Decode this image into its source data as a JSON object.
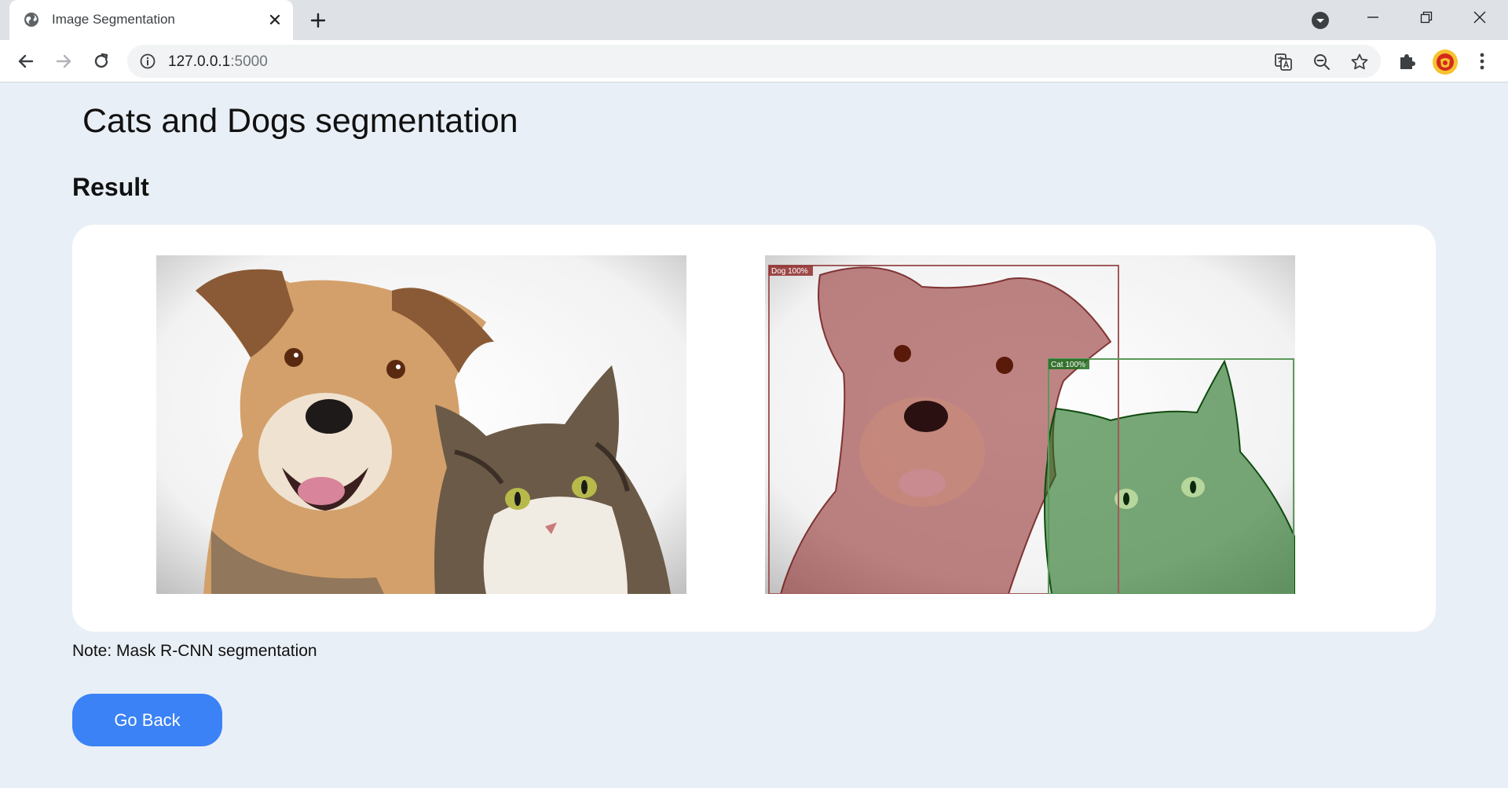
{
  "browser": {
    "tab_title": "Image Segmentation",
    "url_host": "127.0.0.1",
    "url_port": ":5000",
    "icons": {
      "favicon": "globe-icon",
      "tab_close": "close-icon",
      "new_tab": "plus-icon",
      "tab_search": "chevron-down-icon",
      "back": "arrow-left-icon",
      "forward": "arrow-right-icon",
      "reload": "reload-icon",
      "site_info": "info-icon",
      "translate": "translate-icon",
      "zoom": "zoom-out-icon",
      "bookmark": "star-icon",
      "extensions": "puzzle-icon",
      "menu": "kebab-menu-icon"
    },
    "window_controls": [
      "minimize",
      "restore",
      "close"
    ]
  },
  "page": {
    "title": "Cats and Dogs segmentation",
    "section_title": "Result",
    "note": "Note: Mask R-CNN segmentation",
    "go_back_label": "Go Back"
  },
  "images": {
    "original_alt": "Original photo of a dog and a cat",
    "segmented_alt": "Segmented photo with Dog and Cat masks",
    "detections": [
      {
        "label": "Dog 100%",
        "color": "#8b2020"
      },
      {
        "label": "Cat 100%",
        "color": "#1f6e1f"
      }
    ]
  },
  "colors": {
    "page_background": "#e9eff6",
    "button": "#3b82f6",
    "card": "#ffffff"
  }
}
